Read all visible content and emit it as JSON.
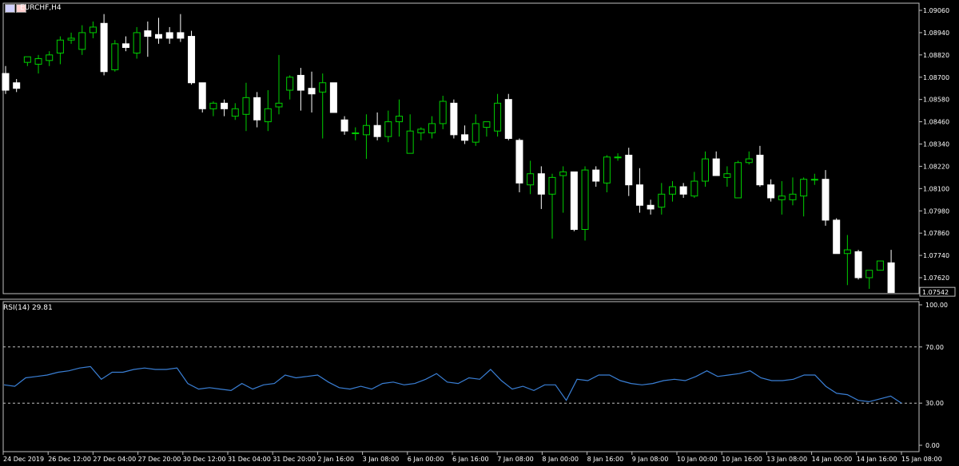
{
  "window": {
    "symbol_title": "EURCHF,H4",
    "rsi_title": "RSI(14) 29.81",
    "current_price": "1.07542"
  },
  "colors": {
    "background": "#000000",
    "bull_fill": "#000000",
    "bull_stroke": "#00d000",
    "bear_fill": "#ffffff",
    "bear_stroke": "#ffffff",
    "rsi_line": "#3a7fd5",
    "axis_text": "#ffffff",
    "frame": "#c0c0c0"
  },
  "chart_data": [
    {
      "type": "candlestick",
      "title": "EURCHF,H4",
      "ylim": [
        1.07542,
        1.0906
      ],
      "y_ticks": [
        "1.09060",
        "1.08940",
        "1.08820",
        "1.08700",
        "1.08580",
        "1.08460",
        "1.08340",
        "1.08220",
        "1.08100",
        "1.07980",
        "1.07860",
        "1.07740",
        "1.07620"
      ],
      "x_ticks": [
        "24 Dec 2019",
        "26 Dec 12:00",
        "27 Dec 04:00",
        "27 Dec 20:00",
        "30 Dec 12:00",
        "31 Dec 04:00",
        "31 Dec 20:00",
        "2 Jan 16:00",
        "3 Jan 08:00",
        "6 Jan 00:00",
        "6 Jan 16:00",
        "7 Jan 08:00",
        "8 Jan 00:00",
        "8 Jan 16:00",
        "9 Jan 08:00",
        "10 Jan 00:00",
        "10 Jan 16:00",
        "13 Jan 08:00",
        "14 Jan 00:00",
        "14 Jan 16:00",
        "15 Jan 08:00"
      ],
      "candles": [
        {
          "o": 1.0872,
          "h": 1.0876,
          "l": 1.0861,
          "c": 1.0863
        },
        {
          "o": 1.0867,
          "h": 1.0869,
          "l": 1.0862,
          "c": 1.0864
        },
        {
          "o": 1.0878,
          "h": 1.0881,
          "l": 1.0876,
          "c": 1.0881
        },
        {
          "o": 1.0877,
          "h": 1.0882,
          "l": 1.0872,
          "c": 1.088
        },
        {
          "o": 1.0879,
          "h": 1.0884,
          "l": 1.0876,
          "c": 1.0882
        },
        {
          "o": 1.0883,
          "h": 1.0892,
          "l": 1.0877,
          "c": 1.089
        },
        {
          "o": 1.089,
          "h": 1.0894,
          "l": 1.0888,
          "c": 1.0891
        },
        {
          "o": 1.0885,
          "h": 1.0898,
          "l": 1.0882,
          "c": 1.0894
        },
        {
          "o": 1.0894,
          "h": 1.09,
          "l": 1.0891,
          "c": 1.0897
        },
        {
          "o": 1.0899,
          "h": 1.0904,
          "l": 1.0871,
          "c": 1.0873
        },
        {
          "o": 1.0874,
          "h": 1.089,
          "l": 1.0873,
          "c": 1.0888
        },
        {
          "o": 1.0888,
          "h": 1.0892,
          "l": 1.0884,
          "c": 1.0886
        },
        {
          "o": 1.0883,
          "h": 1.0897,
          "l": 1.088,
          "c": 1.0894
        },
        {
          "o": 1.0895,
          "h": 1.09,
          "l": 1.0881,
          "c": 1.0892
        },
        {
          "o": 1.0893,
          "h": 1.0902,
          "l": 1.0888,
          "c": 1.0891
        },
        {
          "o": 1.0894,
          "h": 1.0897,
          "l": 1.0888,
          "c": 1.0891
        },
        {
          "o": 1.0894,
          "h": 1.0904,
          "l": 1.0889,
          "c": 1.0891
        },
        {
          "o": 1.0892,
          "h": 1.0895,
          "l": 1.0866,
          "c": 1.0867
        },
        {
          "o": 1.0867,
          "h": 1.0867,
          "l": 1.0851,
          "c": 1.0853
        },
        {
          "o": 1.0853,
          "h": 1.0857,
          "l": 1.0849,
          "c": 1.0856
        },
        {
          "o": 1.0856,
          "h": 1.0858,
          "l": 1.0849,
          "c": 1.0853
        },
        {
          "o": 1.0849,
          "h": 1.0856,
          "l": 1.0847,
          "c": 1.0853
        },
        {
          "o": 1.085,
          "h": 1.0867,
          "l": 1.0841,
          "c": 1.0859
        },
        {
          "o": 1.0859,
          "h": 1.0862,
          "l": 1.0843,
          "c": 1.0847
        },
        {
          "o": 1.0846,
          "h": 1.0863,
          "l": 1.0841,
          "c": 1.0853
        },
        {
          "o": 1.0854,
          "h": 1.0882,
          "l": 1.085,
          "c": 1.0856
        },
        {
          "o": 1.0863,
          "h": 1.0871,
          "l": 1.0858,
          "c": 1.087
        },
        {
          "o": 1.0871,
          "h": 1.0875,
          "l": 1.0852,
          "c": 1.0863
        },
        {
          "o": 1.0864,
          "h": 1.0873,
          "l": 1.0851,
          "c": 1.0861
        },
        {
          "o": 1.0862,
          "h": 1.0872,
          "l": 1.0837,
          "c": 1.0867
        },
        {
          "o": 1.0867,
          "h": 1.0866,
          "l": 1.0851,
          "c": 1.0851
        },
        {
          "o": 1.0847,
          "h": 1.0849,
          "l": 1.0839,
          "c": 1.0841
        },
        {
          "o": 1.084,
          "h": 1.0843,
          "l": 1.0836,
          "c": 1.084
        },
        {
          "o": 1.0839,
          "h": 1.085,
          "l": 1.0826,
          "c": 1.0844
        },
        {
          "o": 1.0844,
          "h": 1.0851,
          "l": 1.0836,
          "c": 1.0838
        },
        {
          "o": 1.0838,
          "h": 1.0852,
          "l": 1.0835,
          "c": 1.0846
        },
        {
          "o": 1.0846,
          "h": 1.0858,
          "l": 1.0838,
          "c": 1.0849
        },
        {
          "o": 1.0829,
          "h": 1.085,
          "l": 1.0829,
          "c": 1.0841
        },
        {
          "o": 1.084,
          "h": 1.0843,
          "l": 1.0836,
          "c": 1.0842
        },
        {
          "o": 1.084,
          "h": 1.0849,
          "l": 1.0837,
          "c": 1.0845
        },
        {
          "o": 1.0845,
          "h": 1.086,
          "l": 1.0842,
          "c": 1.0857
        },
        {
          "o": 1.0856,
          "h": 1.0858,
          "l": 1.0837,
          "c": 1.0839
        },
        {
          "o": 1.0839,
          "h": 1.0844,
          "l": 1.0834,
          "c": 1.0836
        },
        {
          "o": 1.0835,
          "h": 1.085,
          "l": 1.0833,
          "c": 1.0845
        },
        {
          "o": 1.0843,
          "h": 1.0846,
          "l": 1.0838,
          "c": 1.0846
        },
        {
          "o": 1.0841,
          "h": 1.0861,
          "l": 1.0838,
          "c": 1.0856
        },
        {
          "o": 1.0858,
          "h": 1.0861,
          "l": 1.0836,
          "c": 1.0837
        },
        {
          "o": 1.0836,
          "h": 1.0837,
          "l": 1.0808,
          "c": 1.0813
        },
        {
          "o": 1.0812,
          "h": 1.0825,
          "l": 1.0807,
          "c": 1.0818
        },
        {
          "o": 1.0818,
          "h": 1.0822,
          "l": 1.0799,
          "c": 1.0807
        },
        {
          "o": 1.0807,
          "h": 1.0818,
          "l": 1.0783,
          "c": 1.0816
        },
        {
          "o": 1.0817,
          "h": 1.0822,
          "l": 1.0797,
          "c": 1.0819
        },
        {
          "o": 1.0819,
          "h": 1.0819,
          "l": 1.0787,
          "c": 1.0788
        },
        {
          "o": 1.0788,
          "h": 1.0822,
          "l": 1.0782,
          "c": 1.082
        },
        {
          "o": 1.082,
          "h": 1.0822,
          "l": 1.0811,
          "c": 1.0814
        },
        {
          "o": 1.0813,
          "h": 1.0828,
          "l": 1.0808,
          "c": 1.0827
        },
        {
          "o": 1.0827,
          "h": 1.0829,
          "l": 1.0825,
          "c": 1.0827
        },
        {
          "o": 1.0828,
          "h": 1.0832,
          "l": 1.0806,
          "c": 1.0812
        },
        {
          "o": 1.0812,
          "h": 1.0821,
          "l": 1.0797,
          "c": 1.0801
        },
        {
          "o": 1.0801,
          "h": 1.0804,
          "l": 1.0796,
          "c": 1.0799
        },
        {
          "o": 1.08,
          "h": 1.0813,
          "l": 1.0796,
          "c": 1.0807
        },
        {
          "o": 1.0807,
          "h": 1.0814,
          "l": 1.0803,
          "c": 1.0811
        },
        {
          "o": 1.0811,
          "h": 1.0813,
          "l": 1.0805,
          "c": 1.0807
        },
        {
          "o": 1.0806,
          "h": 1.0819,
          "l": 1.0805,
          "c": 1.0814
        },
        {
          "o": 1.0814,
          "h": 1.083,
          "l": 1.0811,
          "c": 1.0826
        },
        {
          "o": 1.0826,
          "h": 1.083,
          "l": 1.0817,
          "c": 1.0817
        },
        {
          "o": 1.0816,
          "h": 1.0822,
          "l": 1.0811,
          "c": 1.0818
        },
        {
          "o": 1.0805,
          "h": 1.0825,
          "l": 1.0805,
          "c": 1.0824
        },
        {
          "o": 1.0824,
          "h": 1.083,
          "l": 1.0823,
          "c": 1.0826
        },
        {
          "o": 1.0828,
          "h": 1.0833,
          "l": 1.0811,
          "c": 1.0812
        },
        {
          "o": 1.0812,
          "h": 1.0815,
          "l": 1.0803,
          "c": 1.0805
        },
        {
          "o": 1.0804,
          "h": 1.0814,
          "l": 1.0796,
          "c": 1.0806
        },
        {
          "o": 1.0804,
          "h": 1.0816,
          "l": 1.0801,
          "c": 1.0807
        },
        {
          "o": 1.0806,
          "h": 1.0816,
          "l": 1.0795,
          "c": 1.0815
        },
        {
          "o": 1.0815,
          "h": 1.0818,
          "l": 1.0812,
          "c": 1.0815
        },
        {
          "o": 1.0815,
          "h": 1.082,
          "l": 1.079,
          "c": 1.0793
        },
        {
          "o": 1.0793,
          "h": 1.0794,
          "l": 1.0779,
          "c": 1.0775
        },
        {
          "o": 1.0775,
          "h": 1.0785,
          "l": 1.0758,
          "c": 1.0777
        },
        {
          "o": 1.0776,
          "h": 1.0777,
          "l": 1.0761,
          "c": 1.0762
        },
        {
          "o": 1.0762,
          "h": 1.0765,
          "l": 1.0756,
          "c": 1.0766
        },
        {
          "o": 1.0766,
          "h": 1.0771,
          "l": 1.0766,
          "c": 1.0771
        },
        {
          "o": 1.077,
          "h": 1.0777,
          "l": 1.0754,
          "c": 1.0754
        }
      ]
    },
    {
      "type": "line",
      "title": "RSI(14) 29.81",
      "ylim": [
        0,
        100
      ],
      "y_ticks": [
        "100.00",
        "70.00",
        "30.00",
        "0.00"
      ],
      "levels": [
        70,
        30
      ],
      "values": [
        43,
        42,
        48,
        49,
        50,
        52,
        53,
        55,
        56,
        47,
        52,
        52,
        54,
        55,
        54,
        54,
        55,
        44,
        40,
        41,
        40,
        39,
        44,
        40,
        43,
        44,
        50,
        48,
        49,
        50,
        45,
        41,
        40,
        42,
        40,
        44,
        45,
        43,
        44,
        47,
        51,
        45,
        44,
        48,
        47,
        54,
        46,
        40,
        42,
        39,
        43,
        43,
        32,
        47,
        46,
        50,
        50,
        46,
        44,
        43,
        44,
        46,
        47,
        46,
        49,
        53,
        49,
        50,
        51,
        53,
        48,
        46,
        46,
        47,
        50,
        50,
        42,
        37,
        36,
        32,
        31,
        33,
        35,
        30
      ]
    }
  ]
}
